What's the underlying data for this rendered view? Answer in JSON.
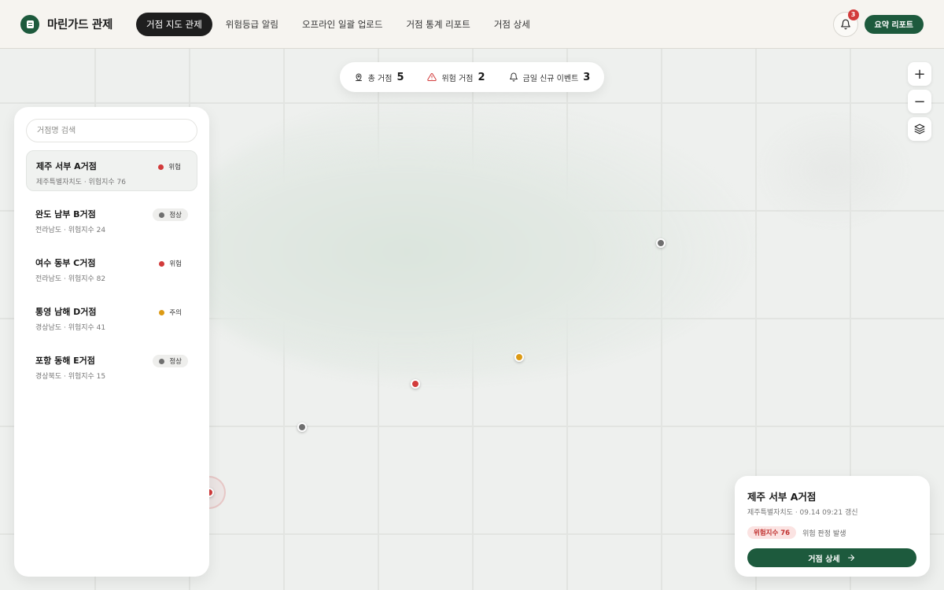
{
  "app": {
    "title": "마린가드 관제"
  },
  "nav": {
    "tabs": [
      {
        "label": "거점 지도 관제",
        "active": true
      },
      {
        "label": "위험등급 알림",
        "active": false
      },
      {
        "label": "오프라인 일괄 업로드",
        "active": false
      },
      {
        "label": "거점 통계 리포트",
        "active": false
      },
      {
        "label": "거점 상세",
        "active": false
      }
    ]
  },
  "header": {
    "notification_count": "3",
    "report_button": "요약 리포트"
  },
  "stats": {
    "total_label": "총 거점",
    "total_value": "5",
    "risk_label": "위험 거점",
    "risk_value": "2",
    "events_label": "금일 신규 이벤트",
    "events_value": "3"
  },
  "controls": {
    "zoom_in": "+",
    "zoom_out": "−"
  },
  "sidebar": {
    "search_placeholder": "거점명 검색",
    "sites": [
      {
        "name": "제주 서부 A거점",
        "sub": "제주특별자치도 · 위험지수 76",
        "status": "위험",
        "color": "#d23b3b",
        "pill": false,
        "selected": true
      },
      {
        "name": "완도 남부 B거점",
        "sub": "전라남도 · 위험지수 24",
        "status": "정상",
        "color": "#6f6f6f",
        "pill": true,
        "selected": false
      },
      {
        "name": "여수 동부 C거점",
        "sub": "전라남도 · 위험지수 82",
        "status": "위험",
        "color": "#d23b3b",
        "pill": false,
        "selected": false
      },
      {
        "name": "통영 남해 D거점",
        "sub": "경상남도 · 위험지수 41",
        "status": "주의",
        "color": "#dc9a14",
        "pill": false,
        "selected": false
      },
      {
        "name": "포항 동해 E거점",
        "sub": "경상북도 · 위험지수 15",
        "status": "정상",
        "color": "#6f6f6f",
        "pill": true,
        "selected": false
      }
    ]
  },
  "detail": {
    "title": "제주 서부 A거점",
    "subtitle": "제주특별자치도 · 09.14 09:21 갱신",
    "risk_badge": "위험지수 76",
    "risk_text": "위험 판정 발생",
    "button": "거점 상세"
  },
  "colors": {
    "brand": "#1d5a3d",
    "danger": "#d23b3b",
    "warning": "#dc9a14",
    "normal": "#6f6f6f"
  }
}
